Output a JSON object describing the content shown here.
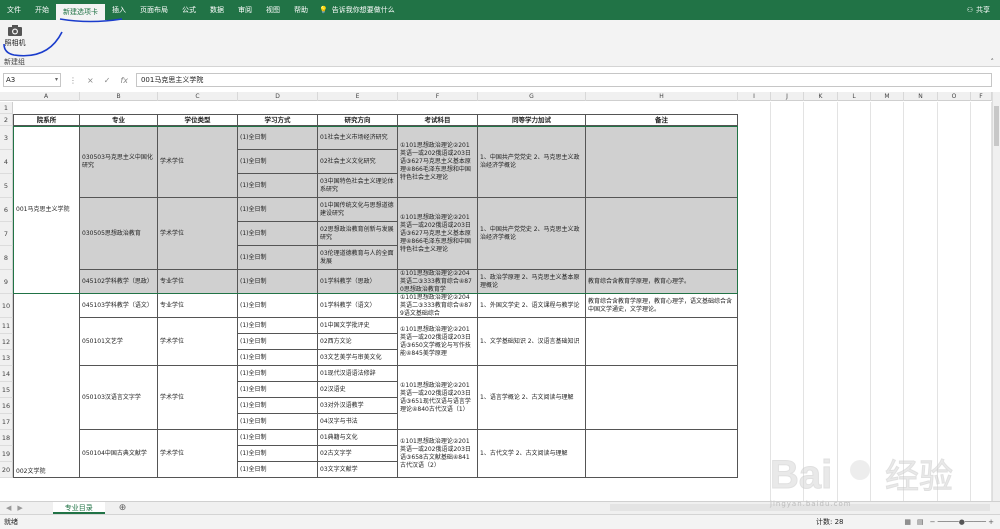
{
  "ribbon_tabs": [
    "文件",
    "开始",
    "新建选项卡",
    "插入",
    "页面布局",
    "公式",
    "数据",
    "审阅",
    "视图",
    "帮助"
  ],
  "tell_me": "告诉我你想要做什么",
  "share": "共享",
  "ribbon": {
    "camera_label": "照相机",
    "group_label": "新建组"
  },
  "formula_bar": {
    "name_box": "A3",
    "cancel": "×",
    "enter": "✓",
    "fx": "fx",
    "content": "001马克思主义学院"
  },
  "columns": [
    "A",
    "B",
    "C",
    "D",
    "E",
    "F",
    "G",
    "H",
    "I",
    "J",
    "K",
    "L",
    "M",
    "N",
    "O",
    "F"
  ],
  "rows": [
    "1",
    "2",
    "3",
    "4",
    "5",
    "6",
    "7",
    "8",
    "9",
    "10",
    "11",
    "12",
    "13",
    "14",
    "15",
    "16",
    "17",
    "18",
    "19",
    "20"
  ],
  "table": {
    "headers": [
      "院系所",
      "专业",
      "学位类型",
      "学习方式",
      "研究方向",
      "考试科目",
      "同等学力加试",
      "备注"
    ],
    "dept1": "001马克思主义学院",
    "dept2": "002文学院",
    "rows": [
      {
        "major": "030503马克思主义中国化研究",
        "degree": "学术学位",
        "mode": "(1)全日制",
        "dir": "01社会主义市场经济研究",
        "exam": "①101思想政治理论②201英语一或202俄语或203日语③627马克思主义基本原理④866毛泽东思想和中国特色社会主义理论",
        "extra": "1、中国共产党党史 2、马克思主义政治经济学概论",
        "note": ""
      },
      {
        "major": "",
        "degree": "",
        "mode": "(1)全日制",
        "dir": "02社会主义文化研究",
        "exam": "",
        "extra": "",
        "note": ""
      },
      {
        "major": "",
        "degree": "",
        "mode": "(1)全日制",
        "dir": "03中国特色社会主义理论体系研究",
        "exam": "",
        "extra": "",
        "note": ""
      },
      {
        "major": "030505思想政治教育",
        "degree": "学术学位",
        "mode": "(1)全日制",
        "dir": "01中国传统文化与思想道德建设研究",
        "exam": "①101思想政治理论②201英语一或202俄语或203日语③627马克思主义基本原理④866毛泽东思想和中国特色社会主义理论",
        "extra": "1、中国共产党党史 2、马克思主义政治经济学概论",
        "note": ""
      },
      {
        "major": "",
        "degree": "",
        "mode": "(1)全日制",
        "dir": "02思想政治教育创新与发展研究",
        "exam": "",
        "extra": "",
        "note": ""
      },
      {
        "major": "",
        "degree": "",
        "mode": "(1)全日制",
        "dir": "03伦理道德教育与人的全面发展",
        "exam": "",
        "extra": "",
        "note": ""
      },
      {
        "major": "045102学科教学（思政）",
        "degree": "专业学位",
        "mode": "(1)全日制",
        "dir": "01学科教学（思政）",
        "exam": "①101思想政治理论②204英语二③333教育综合④870思想政治教育学",
        "extra": "1、政治学原理 2、马克思主义基本原理概论",
        "note": "教育综合含教育学原理，教育心理学。"
      },
      {
        "major": "045103学科教学（语文）",
        "degree": "专业学位",
        "mode": "(1)全日制",
        "dir": "01学科教学（语文）",
        "exam": "①101思想政治理论②204英语二③333教育综合④879语文基础综合",
        "extra": "1、外国文学史 2、语文课程与教学论",
        "note": "教育综合含教育学原理，教育心理学，语文基础综合含中国文学通史，文学理论。"
      },
      {
        "major": "050101文艺学",
        "degree": "学术学位",
        "mode": "(1)全日制",
        "dir": "01中国文学批评史",
        "exam": "①101思想政治理论②201英语一或202俄语或203日语③650文学概论与写作技能④845美学原理",
        "extra": "1、文学基础知识 2、汉语言基础知识",
        "note": ""
      },
      {
        "major": "",
        "degree": "",
        "mode": "(1)全日制",
        "dir": "02西方文论",
        "exam": "",
        "extra": "",
        "note": ""
      },
      {
        "major": "",
        "degree": "",
        "mode": "(1)全日制",
        "dir": "03文艺美学与审美文化",
        "exam": "",
        "extra": "",
        "note": ""
      },
      {
        "major": "050103汉语言文字学",
        "degree": "学术学位",
        "mode": "(1)全日制",
        "dir": "01现代汉语语法修辞",
        "exam": "①101思想政治理论②201英语一或202俄语或203日语③651现代汉语与语言学理论④840古代汉语（1）",
        "extra": "1、语言学概论 2、古文阅读与理解",
        "note": ""
      },
      {
        "major": "",
        "degree": "",
        "mode": "(1)全日制",
        "dir": "02汉语史",
        "exam": "",
        "extra": "",
        "note": ""
      },
      {
        "major": "",
        "degree": "",
        "mode": "(1)全日制",
        "dir": "03对外汉语教学",
        "exam": "",
        "extra": "",
        "note": ""
      },
      {
        "major": "",
        "degree": "",
        "mode": "(1)全日制",
        "dir": "04汉字与书法",
        "exam": "",
        "extra": "",
        "note": ""
      },
      {
        "major": "050104中国古典文献学",
        "degree": "学术学位",
        "mode": "(1)全日制",
        "dir": "01典籍与文化",
        "exam": "①101思想政治理论②201英语一或202俄语或203日语③658古文献基础④841古代汉语（2）",
        "extra": "1、古代文学 2、古文阅读与理解",
        "note": ""
      },
      {
        "major": "",
        "degree": "",
        "mode": "(1)全日制",
        "dir": "02古文字学",
        "exam": "",
        "extra": "",
        "note": ""
      },
      {
        "major": "",
        "degree": "",
        "mode": "(1)全日制",
        "dir": "03文字文献学",
        "exam": "",
        "extra": "",
        "note": ""
      }
    ]
  },
  "sheet_tab": "专业目录",
  "status": {
    "ready": "就绪",
    "count": "计数: 28"
  },
  "watermark": {
    "brand": "Bai",
    "brand2": "经验",
    "url": "jingyan.baidu.com"
  },
  "colors": {
    "excel_green": "#217346",
    "gray_fill": "#d0d0d0",
    "ink_blue": "#1a3ccc"
  }
}
